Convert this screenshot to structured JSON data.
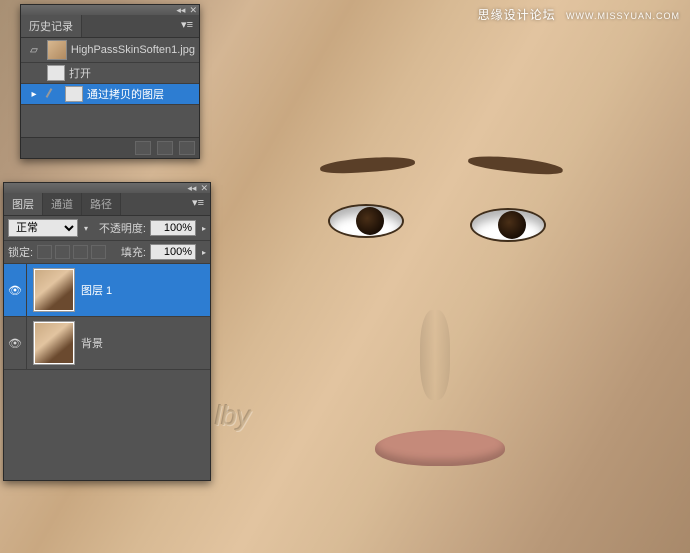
{
  "watermark": {
    "main": "思缘设计论坛",
    "sub": "WWW.MISSYUAN.COM"
  },
  "history_panel": {
    "tab": "历史记录",
    "filename": "HighPassSkinSoften1.jpg",
    "items": [
      {
        "label": "打开",
        "selected": false
      },
      {
        "label": "通过拷贝的图层",
        "selected": true
      }
    ]
  },
  "layers_panel": {
    "tabs": [
      "图层",
      "通道",
      "路径"
    ],
    "blend_mode_options": [
      "正常"
    ],
    "blend_mode": "正常",
    "opacity_label": "不透明度:",
    "opacity_value": "100%",
    "lock_label": "锁定:",
    "fill_label": "填充:",
    "fill_value": "100%",
    "layers": [
      {
        "name": "图层 1",
        "selected": true,
        "visible": true
      },
      {
        "name": "背景",
        "selected": false,
        "visible": true
      }
    ]
  },
  "artist_mark": "lby"
}
